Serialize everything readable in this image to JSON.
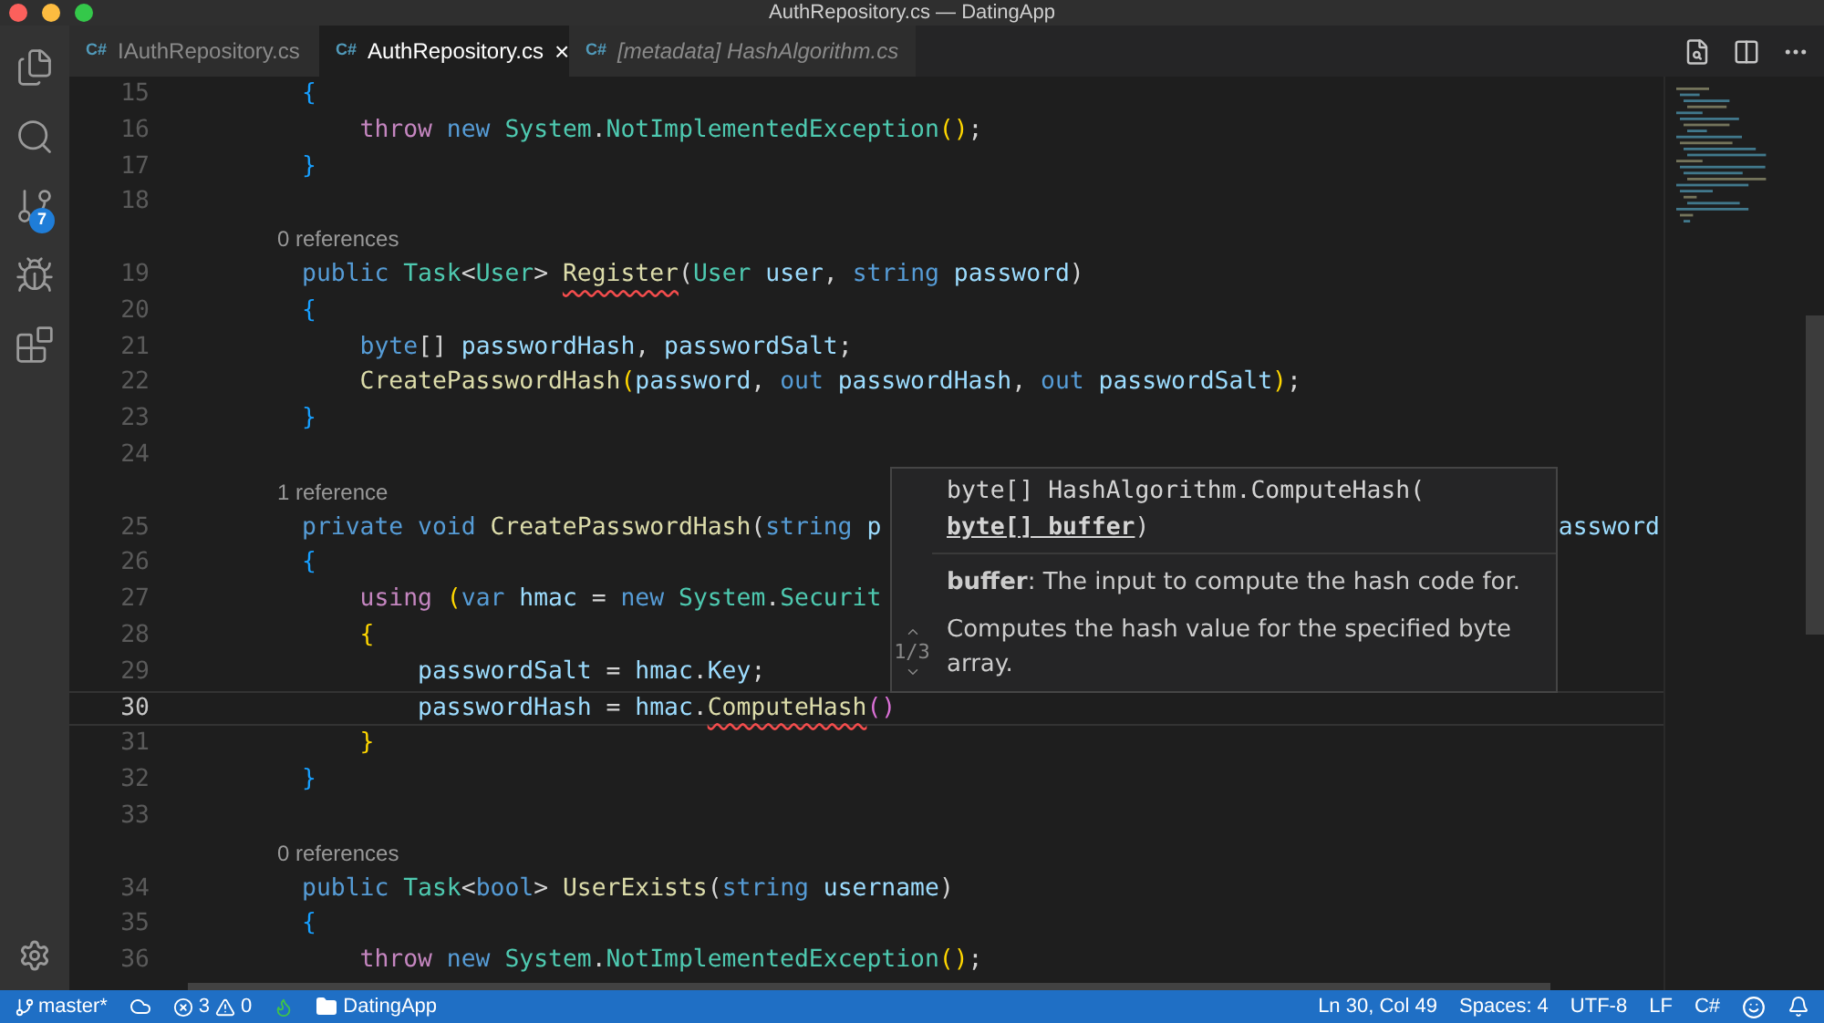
{
  "window": {
    "title": "AuthRepository.cs — DatingApp"
  },
  "activity_bar": {
    "badge": "7"
  },
  "tabs": [
    {
      "lang": "C#",
      "label": "IAuthRepository.cs",
      "selected": false,
      "preview": false
    },
    {
      "lang": "C#",
      "label": "AuthRepository.cs",
      "selected": true,
      "preview": false,
      "close": "×"
    },
    {
      "lang": "C#",
      "label": "[metadata] HashAlgorithm.cs",
      "selected": false,
      "preview": true
    }
  ],
  "editor": {
    "lines": [
      {
        "kind": "code",
        "n": "15",
        "tokens": [
          {
            "kind": "b1",
            "text": "        {"
          }
        ]
      },
      {
        "kind": "code",
        "n": "16",
        "tokens": [
          {
            "kind": "c",
            "text": "            throw"
          },
          {
            "kind": "k",
            "text": " new"
          },
          {
            "kind": "t",
            "text": " System"
          },
          {
            "kind": "p",
            "text": "."
          },
          {
            "kind": "t",
            "text": "NotImplementedException"
          },
          {
            "kind": "b2",
            "text": "()"
          },
          {
            "kind": "p",
            "text": ";"
          }
        ]
      },
      {
        "kind": "code",
        "n": "17",
        "tokens": [
          {
            "kind": "b1",
            "text": "        }"
          }
        ]
      },
      {
        "kind": "code",
        "n": "18"
      },
      {
        "kind": "lens",
        "text": "0 references"
      },
      {
        "kind": "code",
        "n": "19",
        "tokens": [
          {
            "kind": "k",
            "text": "        public"
          },
          {
            "kind": "t",
            "text": " Task"
          },
          {
            "kind": "p",
            "text": "<"
          },
          {
            "kind": "t",
            "text": "User"
          },
          {
            "kind": "p",
            "text": "> "
          },
          {
            "kind": "fe",
            "text": "Register"
          },
          {
            "kind": "p",
            "text": "("
          },
          {
            "kind": "t",
            "text": "User"
          },
          {
            "kind": "v",
            "text": " user"
          },
          {
            "kind": "p",
            "text": ", "
          },
          {
            "kind": "k",
            "text": "string"
          },
          {
            "kind": "v",
            "text": " password"
          },
          {
            "kind": "p",
            "text": ")"
          }
        ]
      },
      {
        "kind": "code",
        "n": "20",
        "tokens": [
          {
            "kind": "b1",
            "text": "        {"
          }
        ]
      },
      {
        "kind": "code",
        "n": "21",
        "tokens": [
          {
            "kind": "k",
            "text": "            byte"
          },
          {
            "kind": "p",
            "text": "[] "
          },
          {
            "kind": "v",
            "text": "passwordHash"
          },
          {
            "kind": "p",
            "text": ", "
          },
          {
            "kind": "v",
            "text": "passwordSalt"
          },
          {
            "kind": "p",
            "text": ";"
          }
        ]
      },
      {
        "kind": "code",
        "n": "22",
        "tokens": [
          {
            "kind": "f",
            "text": "            CreatePasswordHash"
          },
          {
            "kind": "b2",
            "text": "("
          },
          {
            "kind": "v",
            "text": "password"
          },
          {
            "kind": "p",
            "text": ", "
          },
          {
            "kind": "k",
            "text": "out"
          },
          {
            "kind": "v",
            "text": " passwordHash"
          },
          {
            "kind": "p",
            "text": ", "
          },
          {
            "kind": "k",
            "text": "out"
          },
          {
            "kind": "v",
            "text": " passwordSalt"
          },
          {
            "kind": "b2",
            "text": ")"
          },
          {
            "kind": "p",
            "text": ";"
          }
        ]
      },
      {
        "kind": "code",
        "n": "23",
        "tokens": [
          {
            "kind": "b1",
            "text": "        }"
          }
        ]
      },
      {
        "kind": "code",
        "n": "24"
      },
      {
        "kind": "lens",
        "text": "1 reference"
      },
      {
        "kind": "code",
        "n": "25",
        "tokens": [
          {
            "kind": "k",
            "text": "        private"
          },
          {
            "kind": "k",
            "text": " void"
          },
          {
            "kind": "f",
            "text": " CreatePasswordHash"
          },
          {
            "kind": "p",
            "text": "("
          },
          {
            "kind": "k",
            "text": "string"
          },
          {
            "kind": "v",
            "text": " p"
          }
        ],
        "tail": "assword"
      },
      {
        "kind": "code",
        "n": "26",
        "tokens": [
          {
            "kind": "b1",
            "text": "        {"
          }
        ]
      },
      {
        "kind": "code",
        "n": "27",
        "tokens": [
          {
            "kind": "c",
            "text": "            using"
          },
          {
            "kind": "b2",
            "text": " ("
          },
          {
            "kind": "k",
            "text": "var"
          },
          {
            "kind": "v",
            "text": " hmac"
          },
          {
            "kind": "p",
            "text": " = "
          },
          {
            "kind": "k",
            "text": "new"
          },
          {
            "kind": "t",
            "text": " System"
          },
          {
            "kind": "p",
            "text": "."
          },
          {
            "kind": "t",
            "text": "Securit"
          }
        ]
      },
      {
        "kind": "code",
        "n": "28",
        "tokens": [
          {
            "kind": "b2",
            "text": "            {"
          }
        ]
      },
      {
        "kind": "code",
        "n": "29",
        "tokens": [
          {
            "kind": "v",
            "text": "                passwordSalt"
          },
          {
            "kind": "p",
            "text": " = "
          },
          {
            "kind": "v",
            "text": "hmac"
          },
          {
            "kind": "p",
            "text": "."
          },
          {
            "kind": "v",
            "text": "Key"
          },
          {
            "kind": "p",
            "text": ";"
          }
        ]
      },
      {
        "kind": "code",
        "n": "30",
        "current": true,
        "tokens": [
          {
            "kind": "v",
            "text": "                passwordHash"
          },
          {
            "kind": "p",
            "text": " = "
          },
          {
            "kind": "v",
            "text": "hmac"
          },
          {
            "kind": "p",
            "text": "."
          },
          {
            "kind": "fe",
            "text": "ComputeHash"
          },
          {
            "kind": "b3",
            "text": "()"
          }
        ]
      },
      {
        "kind": "code",
        "n": "31",
        "tokens": [
          {
            "kind": "b2",
            "text": "            }"
          }
        ]
      },
      {
        "kind": "code",
        "n": "32",
        "tokens": [
          {
            "kind": "b1",
            "text": "        }"
          }
        ]
      },
      {
        "kind": "code",
        "n": "33"
      },
      {
        "kind": "lens",
        "text": "0 references"
      },
      {
        "kind": "code",
        "n": "34",
        "tokens": [
          {
            "kind": "k",
            "text": "        public"
          },
          {
            "kind": "t",
            "text": " Task"
          },
          {
            "kind": "p",
            "text": "<"
          },
          {
            "kind": "k",
            "text": "bool"
          },
          {
            "kind": "p",
            "text": "> "
          },
          {
            "kind": "f",
            "text": "UserExists"
          },
          {
            "kind": "p",
            "text": "("
          },
          {
            "kind": "k",
            "text": "string"
          },
          {
            "kind": "v",
            "text": " username"
          },
          {
            "kind": "p",
            "text": ")"
          }
        ]
      },
      {
        "kind": "code",
        "n": "35",
        "tokens": [
          {
            "kind": "b1",
            "text": "        {"
          }
        ]
      },
      {
        "kind": "code",
        "n": "36",
        "tokens": [
          {
            "kind": "c",
            "text": "            throw"
          },
          {
            "kind": "k",
            "text": " new"
          },
          {
            "kind": "t",
            "text": " System"
          },
          {
            "kind": "p",
            "text": "."
          },
          {
            "kind": "t",
            "text": "NotImplementedException"
          },
          {
            "kind": "b2",
            "text": "()"
          },
          {
            "kind": "p",
            "text": ";"
          }
        ]
      }
    ]
  },
  "hover": {
    "signature": "byte[] HashAlgorithm.ComputeHash(",
    "parameter": "byte[] buffer",
    "signature_end": ")",
    "param_doc_name": "buffer",
    "param_doc": ": The input to compute the hash code for.",
    "summary": "Computes the hash value for the specified byte array.",
    "counter": "1/3"
  },
  "status_bar": {
    "branch": "master*",
    "errors": "3",
    "warnings": "0",
    "folder": "DatingApp",
    "position": "Ln 30, Col 49",
    "spaces": "Spaces: 4",
    "encoding": "UTF-8",
    "eol": "LF",
    "language": "C#"
  }
}
